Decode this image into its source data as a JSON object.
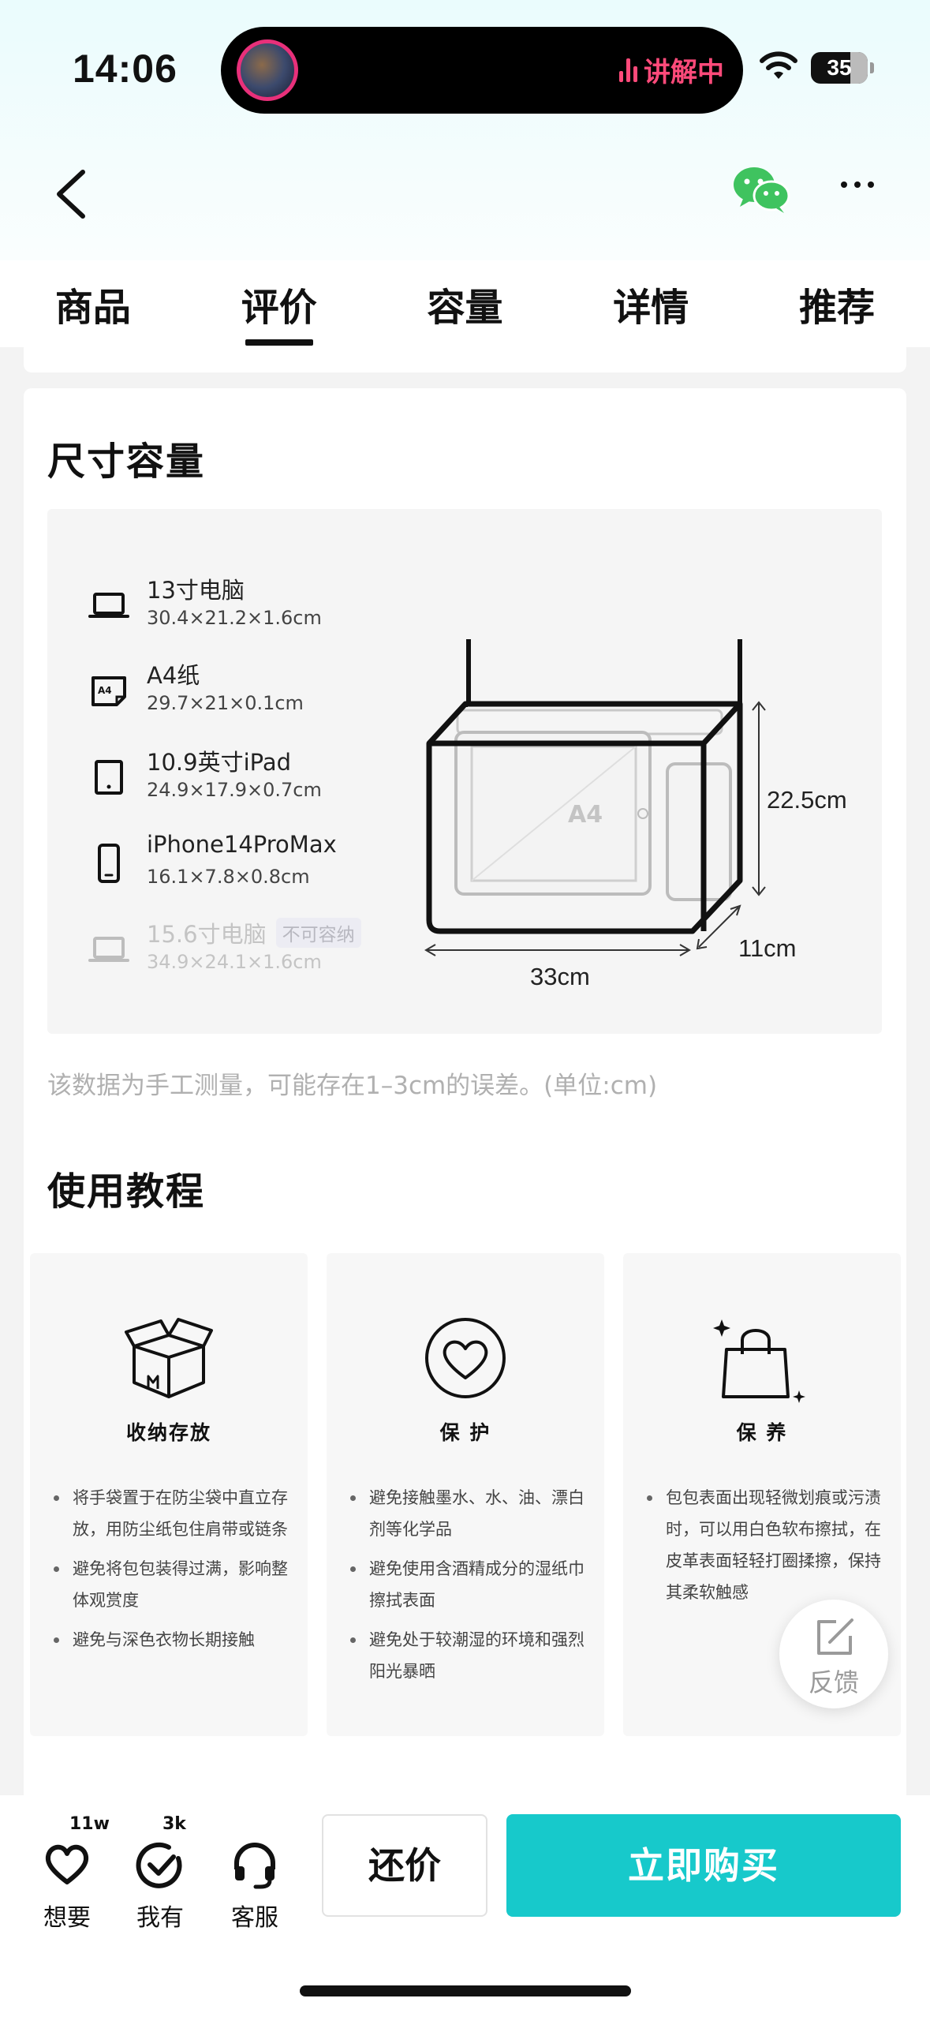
{
  "status": {
    "time": "14:06",
    "live_label": "讲解中",
    "battery": "35"
  },
  "tabs": [
    {
      "label": "商品",
      "active": false
    },
    {
      "label": "评价",
      "active": true
    },
    {
      "label": "容量",
      "active": false
    },
    {
      "label": "详情",
      "active": false
    },
    {
      "label": "推荐",
      "active": false
    }
  ],
  "size_section": {
    "title": "尺寸容量",
    "items": [
      {
        "name": "13寸电脑",
        "dims": "30.4×21.2×1.6cm",
        "icon": "laptop-icon",
        "fits": true
      },
      {
        "name": "A4纸",
        "dims": "29.7×21×0.1cm",
        "icon": "a4-paper-icon",
        "fits": true
      },
      {
        "name": "10.9英寸iPad",
        "dims": "24.9×17.9×0.7cm",
        "icon": "tablet-icon",
        "fits": true
      },
      {
        "name": "iPhone14ProMax",
        "dims": "16.1×7.8×0.8cm",
        "icon": "phone-icon",
        "fits": true
      },
      {
        "name": "15.6寸电脑",
        "dims": "34.9×24.1×1.6cm",
        "icon": "laptop-icon",
        "fits": false,
        "badge": "不可容纳"
      }
    ],
    "diagram": {
      "height": "22.5cm",
      "depth": "11cm",
      "width": "33cm",
      "paper_label": "A4"
    },
    "note": "该数据为手工测量，可能存在1–3cm的误差。(单位:cm)"
  },
  "tutorial": {
    "title": "使用教程",
    "cards": [
      {
        "title": "收纳存放",
        "icon": "box-icon",
        "points": [
          "将手袋置于在防尘袋中直立存放，用防尘纸包住肩带或链条",
          "避免将包包装得过满，影响整体观赏度",
          "避免与深色衣物长期接触"
        ]
      },
      {
        "title": "保 护",
        "icon": "heart-icon",
        "points": [
          "避免接触墨水、水、油、漂白剂等化学品",
          "避免使用含酒精成分的湿纸巾擦拭表面",
          "避免处于较潮湿的环境和强烈阳光暴晒"
        ]
      },
      {
        "title": "保 养",
        "icon": "shopping-bag-icon",
        "points": [
          "包包表面出现轻微划痕或污渍时，可以用白色软布擦拭，在皮革表面轻轻打圈揉擦，保持其柔软触感"
        ]
      }
    ]
  },
  "feedback_label": "反馈",
  "bottom_bar": {
    "want": {
      "label": "想要",
      "count": "11w"
    },
    "have": {
      "label": "我有",
      "count": "3k"
    },
    "service": {
      "label": "客服"
    },
    "bargain_label": "还价",
    "buy_label": "立即购买"
  },
  "colors": {
    "accent": "#17c9cb",
    "live": "#ff4a7a",
    "wechat": "#3fc35f"
  }
}
